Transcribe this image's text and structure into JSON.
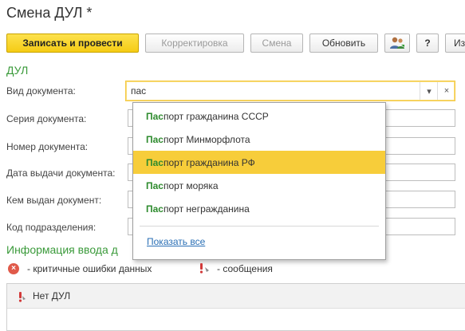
{
  "window": {
    "title": "Смена ДУЛ *"
  },
  "toolbar": {
    "save_post": "Записать и провести",
    "correction": "Корректировка",
    "change": "Смена",
    "refresh": "Обновить",
    "help": "?",
    "more": "Из"
  },
  "form": {
    "section_title": "ДУЛ",
    "doc_type_label": "Вид документа:",
    "doc_type_value": "пас",
    "series_label": "Серия документа:",
    "number_label": "Номер документа:",
    "issue_date_label": "Дата выдачи документа:",
    "issued_by_label": "Кем выдан документ:",
    "division_code_label": "Код подразделения:"
  },
  "dropdown": {
    "match": "Пас",
    "items": [
      {
        "rest": "порт гражданина СССР"
      },
      {
        "rest": "порт Минморфлота"
      },
      {
        "rest": "порт гражданина РФ"
      },
      {
        "rest": "порт моряка"
      },
      {
        "rest": "порт негражданина"
      }
    ],
    "selected_index": 2,
    "show_all": "Показать все"
  },
  "info": {
    "title": "Информация ввода д",
    "legend_errors": "- критичные ошибки данных",
    "legend_messages": "- сообщения",
    "row_text": "Нет ДУЛ"
  },
  "colors": {
    "accent_yellow": "#f5cc15",
    "match_green": "#2e8b2e",
    "section_green": "#3a9a3a",
    "link_blue": "#2a6fb5",
    "error_red": "#e05a4a"
  }
}
